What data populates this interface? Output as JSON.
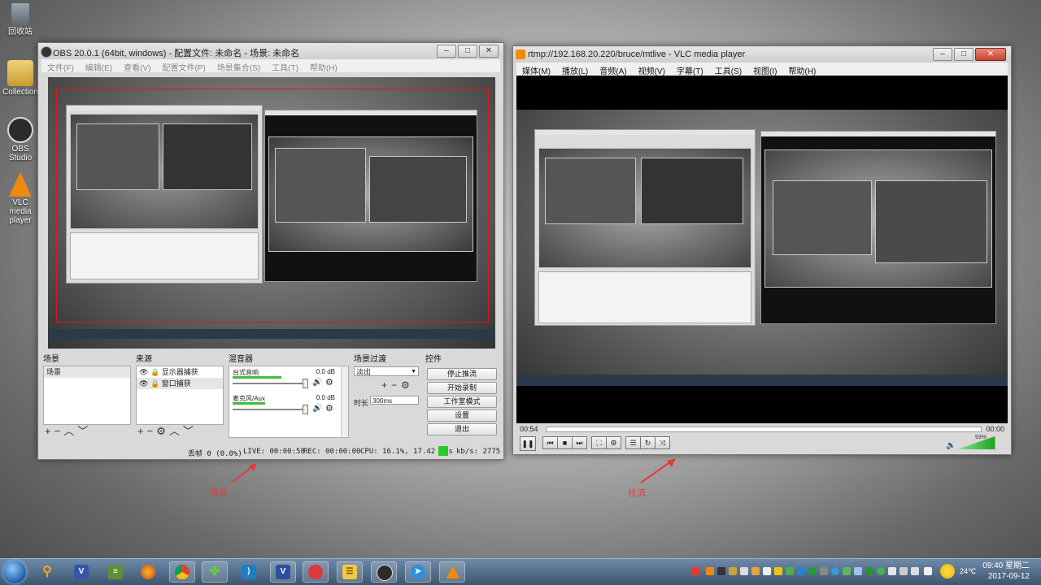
{
  "desktop": {
    "icons": [
      {
        "label": "回收站",
        "icon": "recycle-bin-icon"
      },
      {
        "label": "Collection",
        "icon": "folder-icon"
      },
      {
        "label": "OBS Studio",
        "icon": "obs-icon"
      },
      {
        "label": "VLC media player",
        "icon": "vlc-cone-icon"
      }
    ]
  },
  "obs": {
    "title": "OBS 20.0.1 (64bit, windows) - 配置文件: 未命名 - 场景: 未命名",
    "menu": [
      "文件(F)",
      "编辑(E)",
      "查看(V)",
      "配置文件(P)",
      "场景集合(S)",
      "工具(T)",
      "帮助(H)"
    ],
    "docks": {
      "scenes_title": "场景",
      "scenes": [
        "场景"
      ],
      "sources_title": "来源",
      "sources": [
        "显示器捕获",
        "窗口捕获"
      ],
      "mixer_title": "混音器",
      "mixer": [
        {
          "name": "台式音响",
          "level": "0.0 dB"
        },
        {
          "name": "麦克风/Aux",
          "level": "0.0 dB"
        }
      ],
      "transitions_title": "场景过渡",
      "transition_value": "淡出",
      "duration_label": "时长",
      "duration_value": "300ms",
      "controls_title": "控件",
      "controls": [
        "停止推流",
        "开始录制",
        "工作室模式",
        "设置",
        "退出"
      ]
    },
    "status": {
      "dropped": "丢帧 0 (0.0%)",
      "live": "LIVE: 00:00:58",
      "rec": "REC: 00:00:00",
      "cpu": "CPU: 16.1%, 17.42 fps",
      "kbps": "kb/s: 2775",
      "indicator_color": "#22cc22"
    }
  },
  "vlc": {
    "title": "rtmp://192.168.20.220/bruce/mtlive - VLC media player",
    "menu": [
      "媒体(M)",
      "播放(L)",
      "音频(A)",
      "视频(V)",
      "字幕(T)",
      "工具(S)",
      "视图(I)",
      "帮助(H)"
    ],
    "elapsed": "00:54",
    "remaining": "00:00",
    "volume": "93%",
    "volume_level": 0.93
  },
  "annotations": {
    "push": "推流",
    "pull": "拉流",
    "color": "#e23b3b"
  },
  "taskbar": {
    "temperature": "24℃",
    "time": "09:40 星期二",
    "date": "2017-09-12"
  }
}
